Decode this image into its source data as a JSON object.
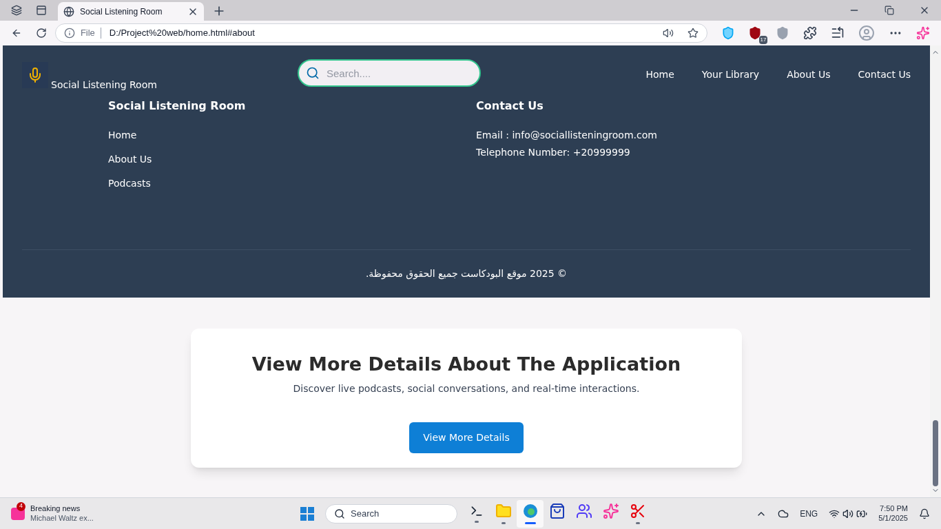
{
  "browser": {
    "tab_title": "Social Listening Room",
    "address_prefix": "File",
    "url": "D:/Project%20web/home.html#about",
    "extension_badge": "17"
  },
  "header": {
    "brand": "Social Listening Room",
    "search_placeholder": "Search....",
    "nav": [
      {
        "label": "Home"
      },
      {
        "label": "Your Library"
      },
      {
        "label": "About Us"
      },
      {
        "label": "Contact Us"
      }
    ]
  },
  "footer": {
    "columns": [
      {
        "title": "Social Listening Room",
        "kind": "links",
        "items": [
          "Home",
          "About Us",
          "Podcasts"
        ]
      },
      {
        "title": "Contact Us",
        "kind": "text",
        "items": [
          "Email : info@sociallisteningroom.com",
          "Telephone Number: +20999999"
        ]
      }
    ],
    "copyright": "© 2025 موقع البودكاست جميع الحقوق محفوظة."
  },
  "cta": {
    "title": "View More Details About The Application",
    "subtitle": "Discover live podcasts, social conversations, and real-time interactions.",
    "button": "View More Details"
  },
  "taskbar": {
    "news_badge": "4",
    "news_title": "Breaking news",
    "news_text": "Michael Waltz ex...",
    "search": "Search",
    "apps": [
      {
        "kind": "terminal",
        "running": true,
        "selected": false
      },
      {
        "kind": "folder",
        "running": true,
        "selected": false
      },
      {
        "kind": "edge",
        "running": true,
        "selected": true
      },
      {
        "kind": "store",
        "running": false,
        "selected": false
      },
      {
        "kind": "teams",
        "running": false,
        "selected": false
      },
      {
        "kind": "copilot",
        "running": false,
        "selected": false
      },
      {
        "kind": "snip",
        "running": true,
        "selected": false
      }
    ],
    "language": "ENG",
    "time": "7:50 PM",
    "date": "5/1/2025"
  }
}
